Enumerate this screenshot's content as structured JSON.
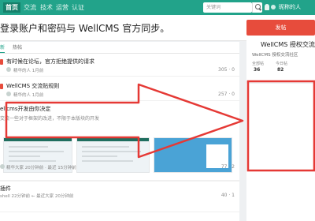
{
  "nav": {
    "items": [
      "首页",
      "交流",
      "技术",
      "运营",
      "认证"
    ],
    "search_placeholder": "关键词",
    "user_name": "昵称的人"
  },
  "notice": {
    "text": "登录账户和密码与 WellCMS 官方同步。",
    "publish_label": "发帖"
  },
  "tabs": [
    "新",
    "热帖"
  ],
  "threads": [
    {
      "title": "有时候在论坛，官方拒绝提供的请求",
      "meta": "精华的人 1月前",
      "stats": "305 · 0"
    },
    {
      "title": "WellCMS 交流贴规则",
      "meta": "精华的人 1月前",
      "stats": "257 · 0"
    },
    {
      "title": "ellcms开发由你决定",
      "meta": "交流一些对于框架的改进，不限于本版块的开发",
      "stats": ""
    },
    {
      "title": "",
      "meta": "精华大家 20分钟前 · 最近 15分钟前",
      "stats": "77 · 2"
    },
    {
      "title": "插件",
      "meta": "shell 22分钟前 ← 最近大家 20分钟前",
      "stats": "40 · 1"
    }
  ],
  "sidebar": {
    "title": "WellCMS 授权交流社区",
    "subtitle": "WellCMS 授权交流社区",
    "stats": [
      {
        "label": "全部帖",
        "value": "36"
      },
      {
        "label": "今日帖",
        "value": "82"
      },
      {
        "label": "",
        "value": ""
      }
    ]
  },
  "colors": {
    "brand": "#22a38a",
    "accent": "#e74c3c",
    "annotation": "#e53935"
  }
}
